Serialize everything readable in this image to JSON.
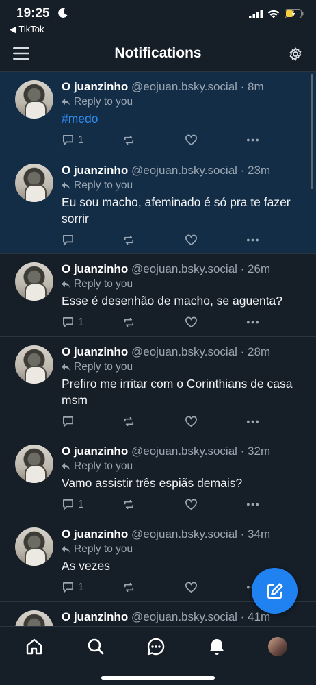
{
  "status_bar": {
    "time": "19:25",
    "back_app": "◀ TikTok"
  },
  "header": {
    "title": "Notifications"
  },
  "notifications": [
    {
      "author": "O juanzinho",
      "handle": "@eojuan.bsky.social",
      "time": "· 8m",
      "reply_label": "Reply to you",
      "text": "#medo",
      "reply_count": "1",
      "unread": true
    },
    {
      "author": "O juanzinho",
      "handle": "@eojuan.bsky.social",
      "time": "· 23m",
      "reply_label": "Reply to you",
      "text": "Eu sou macho, afeminado é só pra te fazer sorrir",
      "reply_count": "",
      "unread": true
    },
    {
      "author": "O juanzinho",
      "handle": "@eojuan.bsky.social",
      "time": "· 26m",
      "reply_label": "Reply to you",
      "text": "Esse é desenhão de macho, se aguenta?",
      "reply_count": "1",
      "unread": false
    },
    {
      "author": "O juanzinho",
      "handle": "@eojuan.bsky.social",
      "time": "· 28m",
      "reply_label": "Reply to you",
      "text": "Prefiro me irritar com o Corinthians de casa msm",
      "reply_count": "",
      "unread": false
    },
    {
      "author": "O juanzinho",
      "handle": "@eojuan.bsky.social",
      "time": "· 32m",
      "reply_label": "Reply to you",
      "text": "Vamo assistir três espiãs demais?",
      "reply_count": "1",
      "unread": false
    },
    {
      "author": "O juanzinho",
      "handle": "@eojuan.bsky.social",
      "time": "· 34m",
      "reply_label": "Reply to you",
      "text": "As vezes",
      "reply_count": "1",
      "unread": false
    },
    {
      "author": "O juanzinho",
      "handle": "@eojuan.bsky.social",
      "time": "· 41m",
      "reply_label": "",
      "text": "",
      "reply_count": "",
      "unread": false
    }
  ],
  "bottom_nav": [
    "home-icon",
    "search-icon",
    "chat-icon",
    "bell-icon",
    "profile-avatar"
  ],
  "colors": {
    "background": "#161e27",
    "unread": "#142d46",
    "accent": "#1f82f0",
    "muted": "#9aa6b2"
  }
}
